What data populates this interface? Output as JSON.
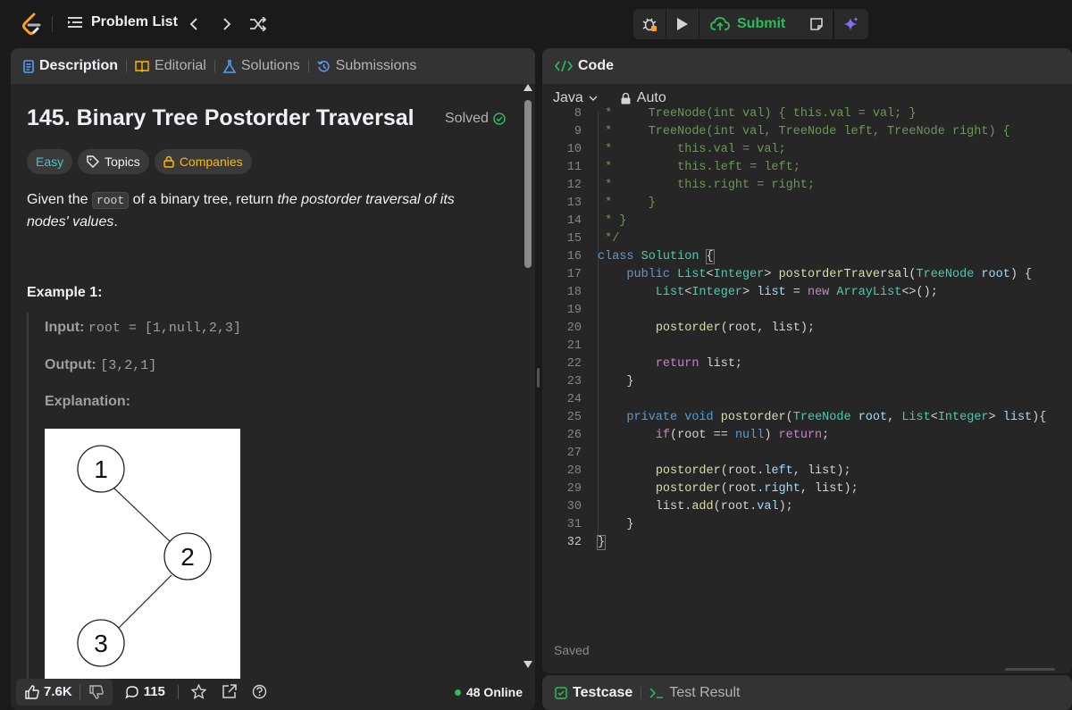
{
  "nav": {
    "problem_list": "Problem List",
    "submit": "Submit"
  },
  "left_tabs": [
    {
      "label": "Description"
    },
    {
      "label": "Editorial"
    },
    {
      "label": "Solutions"
    },
    {
      "label": "Submissions"
    }
  ],
  "problem": {
    "title": "145. Binary Tree Postorder Traversal",
    "status": "Solved",
    "difficulty": "Easy",
    "topics": "Topics",
    "companies": "Companies",
    "statement_pre": "Given the ",
    "statement_code": "root",
    "statement_mid": " of a binary tree, return ",
    "statement_em": "the postorder traversal of its nodes' values",
    "statement_end": "."
  },
  "example": {
    "title": "Example 1:",
    "input_label": "Input:",
    "input_value": "root = [1,null,2,3]",
    "output_label": "Output:",
    "output_value": "[3,2,1]",
    "explanation_label": "Explanation:",
    "tree_nodes": [
      "1",
      "2",
      "3"
    ]
  },
  "footer": {
    "likes": "7.6K",
    "comments": "115",
    "online": "48 Online"
  },
  "code_panel": {
    "title": "Code",
    "language": "Java",
    "mode": "Auto",
    "saved": "Saved",
    "current_line": 32
  },
  "bottom_tabs": {
    "testcase": "Testcase",
    "test_result": "Test Result"
  },
  "colors": {
    "accent_green": "#2cbb5d",
    "easy": "#46c6c2",
    "companies": "#ffb800",
    "panel": "#262626",
    "tabbar": "#333333"
  }
}
